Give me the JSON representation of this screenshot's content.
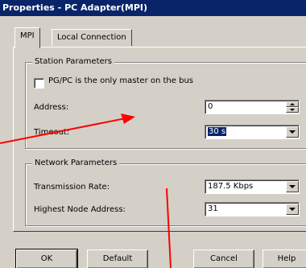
{
  "window": {
    "title": "Properties - PC Adapter(MPI)"
  },
  "tabs": [
    {
      "label": "MPI",
      "active": true
    },
    {
      "label": "Local Connection",
      "active": false
    }
  ],
  "station_parameters": {
    "title": "Station Parameters",
    "only_master_label": "PG/PC is the only master on the bus",
    "only_master_checked": false,
    "address_label": "Address:",
    "address_value": "0",
    "timeout_label": "Timeout:",
    "timeout_value": "30 s"
  },
  "network_parameters": {
    "title": "Network Parameters",
    "transmission_rate_label": "Transmission Rate:",
    "transmission_rate_value": "187.5 Kbps",
    "highest_node_label": "Highest Node Address:",
    "highest_node_value": "31"
  },
  "buttons": {
    "ok": "OK",
    "default": "Default",
    "cancel": "Cancel",
    "help": "Help"
  },
  "colors": {
    "titlebar": "#0a246a",
    "dialog_face": "#d4d0c8",
    "annotation_arrow": "#ff0000"
  }
}
